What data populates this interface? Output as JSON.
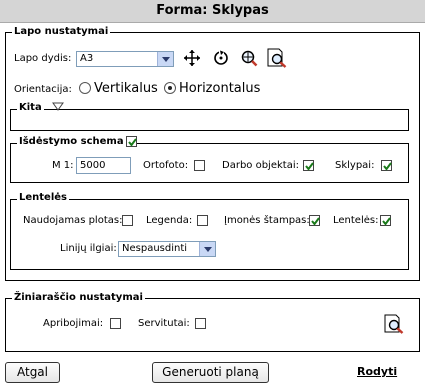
{
  "window": {
    "title": "Forma: Sklypas"
  },
  "page_settings": {
    "legend": "Lapo nustatymai",
    "page_size_label": "Lapo dydis:",
    "page_size_value": "A3",
    "orientation_label": "Orientacija:",
    "orientation_options": [
      "Vertikalus",
      "Horizontalus"
    ],
    "orientation_selected": "Horizontalus"
  },
  "other": {
    "legend": "Kita"
  },
  "layout_scheme": {
    "legend": "Išdėstymo schema",
    "enabled": true,
    "scale_label": "M 1:",
    "scale_value": "5000",
    "ortofoto_label": "Ortofoto:",
    "ortofoto_checked": false,
    "work_objects_label": "Darbo objektai:",
    "work_objects_checked": true,
    "parcels_label": "Sklypai:",
    "parcels_checked": true
  },
  "tables": {
    "legend": "Lentelės",
    "used_area_label": "Naudojamas plotas:",
    "used_area_checked": false,
    "legend_label": "Legenda:",
    "legend_checked": false,
    "company_stamp_label": "Įmonės štampas:",
    "company_stamp_checked": true,
    "tables_label": "Lentelės:",
    "tables_checked": true,
    "line_lengths_label": "Linijų ilgiai:",
    "line_lengths_value": "Nespausdinti"
  },
  "register_settings": {
    "legend": "Žiniaraščio nustatymai",
    "restrictions_label": "Apribojimai:",
    "restrictions_checked": false,
    "servitudes_label": "Servitutai:",
    "servitudes_checked": false
  },
  "footer": {
    "back_label": "Atgal",
    "generate_label": "Generuoti planą",
    "show_label": "Rodyti"
  },
  "icons": [
    "move-icon",
    "rotate-icon",
    "zoom-extent-icon",
    "page-preview-icon",
    "page-preview-icon"
  ],
  "colors": {
    "check": "#1a7a1a",
    "titlebar": "#d5d5d5"
  }
}
